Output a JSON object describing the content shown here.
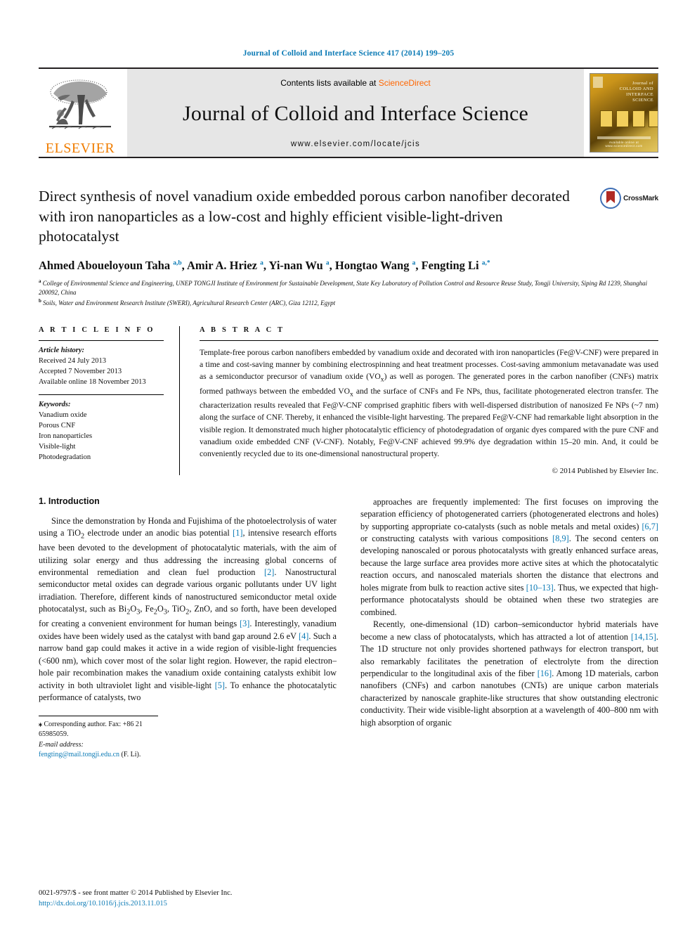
{
  "running_head": "Journal of Colloid and Interface Science 417 (2014) 199–205",
  "masthead": {
    "publisher_name": "ELSEVIER",
    "contents_text": "Contents lists available at",
    "sciencedirect": "ScienceDirect",
    "journal_title": "Journal of Colloid and Interface Science",
    "journal_url": "www.elsevier.com/locate/jcis",
    "cover_line1": "Journal of",
    "cover_line2": "COLLOID AND",
    "cover_line3": "INTERFACE",
    "cover_line4": "SCIENCE",
    "cover_footer": "Available online at www.sciencedirect.com"
  },
  "article": {
    "title": "Direct synthesis of novel vanadium oxide embedded porous carbon nanofiber decorated with iron nanoparticles as a low-cost and highly efficient visible-light-driven photocatalyst",
    "crossmark_label": "CrossMark",
    "authors_html": "Ahmed Aboueloyoun Taha <sup>a,b</sup>, Amir A. Hriez <sup>a</sup>, Yi-nan Wu <sup>a</sup>, Hongtao Wang <sup>a</sup>, Fengting Li <sup>a,*</sup>",
    "affiliation_a": "College of Environmental Science and Engineering, UNEP TONGJI Institute of Environment for Sustainable Development, State Key Laboratory of Pollution Control and Resource Reuse Study, Tongji University, Siping Rd 1239, Shanghai 200092, China",
    "affiliation_b": "Soils, Water and Environment Research Institute (SWERI), Agricultural Research Center (ARC), Giza 12112, Egypt"
  },
  "article_info": {
    "heading": "A R T I C L E   I N F O",
    "history_label": "Article history:",
    "received": "Received 24 July 2013",
    "accepted": "Accepted 7 November 2013",
    "available": "Available online 18 November 2013",
    "keywords_label": "Keywords:",
    "keywords": [
      "Vanadium oxide",
      "Porous CNF",
      "Iron nanoparticles",
      "Visible-light",
      "Photodegradation"
    ]
  },
  "abstract": {
    "heading": "A B S T R A C T",
    "body_html": "Template-free porous carbon nanofibers embedded by vanadium oxide and decorated with iron nanoparticles (Fe@V-CNF) were prepared in a time and cost-saving manner by combining electrospinning and heat treatment processes. Cost-saving ammonium metavanadate was used as a semiconductor precursor of vanadium oxide (VO<sub>x</sub>) as well as porogen. The generated pores in the carbon nanofiber (CNFs) matrix formed pathways between the embedded VO<sub>x</sub> and the surface of CNFs and Fe NPs, thus, facilitate photogenerated electron transfer. The characterization results revealed that Fe@V-CNF comprised graphitic fibers with well-dispersed distribution of nanosized Fe NPs (~7 nm) along the surface of CNF. Thereby, it enhanced the visible-light harvesting. The prepared Fe@V-CNF had remarkable light absorption in the visible region. It demonstrated much higher photocatalytic efficiency of photodegradation of organic dyes compared with the pure CNF and vanadium oxide embedded CNF (V-CNF). Notably, Fe@V-CNF achieved 99.9% dye degradation within 15–20 min. And, it could be conveniently recycled due to its one-dimensional nanostructural property.",
    "copyright": "© 2014 Published by Elsevier Inc."
  },
  "introduction": {
    "section_title": "1. Introduction",
    "left_paragraph_html": "Since the demonstration by Honda and Fujishima of the photoelectrolysis of water using a TiO<sub>2</sub> electrode under an anodic bias potential <span class=\"ref\">[1]</span>, intensive research efforts have been devoted to the development of photocatalytic materials, with the aim of utilizing solar energy and thus addressing the increasing global concerns of environmental remediation and clean fuel production <span class=\"ref\">[2]</span>. Nanostructural semiconductor metal oxides can degrade various organic pollutants under UV light irradiation. Therefore, different kinds of nanostructured semiconductor metal oxide photocatalyst, such as Bi<sub>2</sub>O<sub>3</sub>, Fe<sub>2</sub>O<sub>3</sub>, TiO<sub>2</sub>, ZnO, and so forth, have been developed for creating a convenient environment for human beings <span class=\"ref\">[3]</span>. Interestingly, vanadium oxides have been widely used as the catalyst with band gap around 2.6 eV <span class=\"ref\">[4]</span>. Such a narrow band gap could makes it active in a wide region of visible-light frequencies (&lt;600 nm), which cover most of the solar light region. However, the rapid electron–hole pair recombination makes the vanadium oxide containing catalysts exhibit low activity in both ultraviolet light and visible-light <span class=\"ref\">[5]</span>. To enhance the photocatalytic performance of catalysts, two",
    "right_paragraph1_html": "approaches are frequently implemented: The first focuses on improving the separation efficiency of photogenerated carriers (photogenerated electrons and holes) by supporting appropriate co-catalysts (such as noble metals and metal oxides) <span class=\"ref\">[6,7]</span> or constructing catalysts with various compositions <span class=\"ref\">[8,9]</span>. The second centers on developing nanoscaled or porous photocatalysts with greatly enhanced surface areas, because the large surface area provides more active sites at which the photocatalytic reaction occurs, and nanoscaled materials shorten the distance that electrons and holes migrate from bulk to reaction active sites <span class=\"ref\">[10–13]</span>. Thus, we expected that high-performance photocatalysts should be obtained when these two strategies are combined.",
    "right_paragraph2_html": "Recently, one-dimensional (1D) carbon–semiconductor hybrid materials have become a new class of photocatalysts, which has attracted a lot of attention <span class=\"ref\">[14,15]</span>. The 1D structure not only provides shortened pathways for electron transport, but also remarkably facilitates the penetration of electrolyte from the direction perpendicular to the longitudinal axis of the fiber <span class=\"ref\">[16]</span>. Among 1D materials, carbon nanofibers (CNFs) and carbon nanotubes (CNTs) are unique carbon materials characterized by nanoscale graphite-like structures that show outstanding electronic conductivity. Their wide visible-light absorption at a wavelength of 400–800 nm with high absorption of organic"
  },
  "footnote": {
    "corresponding_html": "<b>⁎</b> Corresponding author. Fax: +86 21 65985059.",
    "email_label": "E-mail address:",
    "email": "fengting@mail.tongji.edu.cn",
    "email_owner": "(F. Li)."
  },
  "page_footer": {
    "issn_line": "0021-9797/$ - see front matter © 2014 Published by Elsevier Inc.",
    "doi": "http://dx.doi.org/10.1016/j.jcis.2013.11.015"
  },
  "colors": {
    "link_blue": "#0b7ab5",
    "elsevier_orange": "#f07d00",
    "sciencedirect_orange": "#ff6600",
    "banner_gray": "#e6e6e6"
  }
}
